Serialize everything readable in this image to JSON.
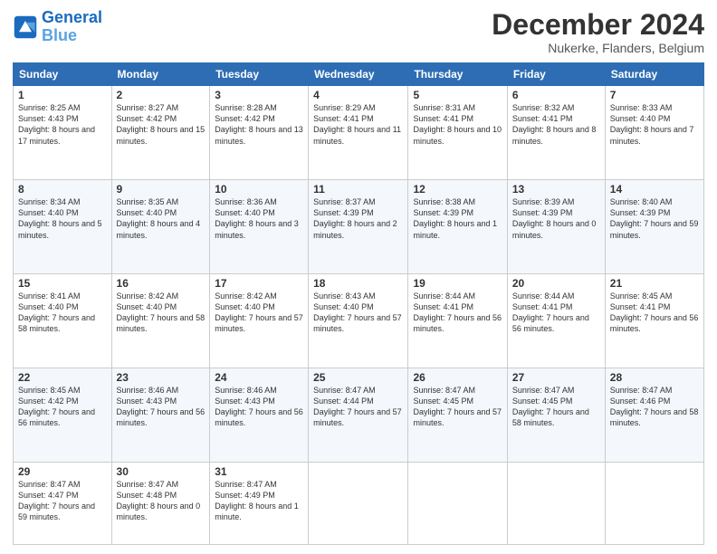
{
  "header": {
    "logo_line1": "General",
    "logo_line2": "Blue",
    "month": "December 2024",
    "location": "Nukerke, Flanders, Belgium"
  },
  "days": [
    "Sunday",
    "Monday",
    "Tuesday",
    "Wednesday",
    "Thursday",
    "Friday",
    "Saturday"
  ],
  "weeks": [
    [
      {
        "num": "1",
        "sunrise": "8:25 AM",
        "sunset": "4:43 PM",
        "daylight": "8 hours and 17 minutes."
      },
      {
        "num": "2",
        "sunrise": "8:27 AM",
        "sunset": "4:42 PM",
        "daylight": "8 hours and 15 minutes."
      },
      {
        "num": "3",
        "sunrise": "8:28 AM",
        "sunset": "4:42 PM",
        "daylight": "8 hours and 13 minutes."
      },
      {
        "num": "4",
        "sunrise": "8:29 AM",
        "sunset": "4:41 PM",
        "daylight": "8 hours and 11 minutes."
      },
      {
        "num": "5",
        "sunrise": "8:31 AM",
        "sunset": "4:41 PM",
        "daylight": "8 hours and 10 minutes."
      },
      {
        "num": "6",
        "sunrise": "8:32 AM",
        "sunset": "4:41 PM",
        "daylight": "8 hours and 8 minutes."
      },
      {
        "num": "7",
        "sunrise": "8:33 AM",
        "sunset": "4:40 PM",
        "daylight": "8 hours and 7 minutes."
      }
    ],
    [
      {
        "num": "8",
        "sunrise": "8:34 AM",
        "sunset": "4:40 PM",
        "daylight": "8 hours and 5 minutes."
      },
      {
        "num": "9",
        "sunrise": "8:35 AM",
        "sunset": "4:40 PM",
        "daylight": "8 hours and 4 minutes."
      },
      {
        "num": "10",
        "sunrise": "8:36 AM",
        "sunset": "4:40 PM",
        "daylight": "8 hours and 3 minutes."
      },
      {
        "num": "11",
        "sunrise": "8:37 AM",
        "sunset": "4:39 PM",
        "daylight": "8 hours and 2 minutes."
      },
      {
        "num": "12",
        "sunrise": "8:38 AM",
        "sunset": "4:39 PM",
        "daylight": "8 hours and 1 minute."
      },
      {
        "num": "13",
        "sunrise": "8:39 AM",
        "sunset": "4:39 PM",
        "daylight": "8 hours and 0 minutes."
      },
      {
        "num": "14",
        "sunrise": "8:40 AM",
        "sunset": "4:39 PM",
        "daylight": "7 hours and 59 minutes."
      }
    ],
    [
      {
        "num": "15",
        "sunrise": "8:41 AM",
        "sunset": "4:40 PM",
        "daylight": "7 hours and 58 minutes."
      },
      {
        "num": "16",
        "sunrise": "8:42 AM",
        "sunset": "4:40 PM",
        "daylight": "7 hours and 58 minutes."
      },
      {
        "num": "17",
        "sunrise": "8:42 AM",
        "sunset": "4:40 PM",
        "daylight": "7 hours and 57 minutes."
      },
      {
        "num": "18",
        "sunrise": "8:43 AM",
        "sunset": "4:40 PM",
        "daylight": "7 hours and 57 minutes."
      },
      {
        "num": "19",
        "sunrise": "8:44 AM",
        "sunset": "4:41 PM",
        "daylight": "7 hours and 56 minutes."
      },
      {
        "num": "20",
        "sunrise": "8:44 AM",
        "sunset": "4:41 PM",
        "daylight": "7 hours and 56 minutes."
      },
      {
        "num": "21",
        "sunrise": "8:45 AM",
        "sunset": "4:41 PM",
        "daylight": "7 hours and 56 minutes."
      }
    ],
    [
      {
        "num": "22",
        "sunrise": "8:45 AM",
        "sunset": "4:42 PM",
        "daylight": "7 hours and 56 minutes."
      },
      {
        "num": "23",
        "sunrise": "8:46 AM",
        "sunset": "4:43 PM",
        "daylight": "7 hours and 56 minutes."
      },
      {
        "num": "24",
        "sunrise": "8:46 AM",
        "sunset": "4:43 PM",
        "daylight": "7 hours and 56 minutes."
      },
      {
        "num": "25",
        "sunrise": "8:47 AM",
        "sunset": "4:44 PM",
        "daylight": "7 hours and 57 minutes."
      },
      {
        "num": "26",
        "sunrise": "8:47 AM",
        "sunset": "4:45 PM",
        "daylight": "7 hours and 57 minutes."
      },
      {
        "num": "27",
        "sunrise": "8:47 AM",
        "sunset": "4:45 PM",
        "daylight": "7 hours and 58 minutes."
      },
      {
        "num": "28",
        "sunrise": "8:47 AM",
        "sunset": "4:46 PM",
        "daylight": "7 hours and 58 minutes."
      }
    ],
    [
      {
        "num": "29",
        "sunrise": "8:47 AM",
        "sunset": "4:47 PM",
        "daylight": "7 hours and 59 minutes."
      },
      {
        "num": "30",
        "sunrise": "8:47 AM",
        "sunset": "4:48 PM",
        "daylight": "8 hours and 0 minutes."
      },
      {
        "num": "31",
        "sunrise": "8:47 AM",
        "sunset": "4:49 PM",
        "daylight": "8 hours and 1 minute."
      },
      null,
      null,
      null,
      null
    ]
  ]
}
